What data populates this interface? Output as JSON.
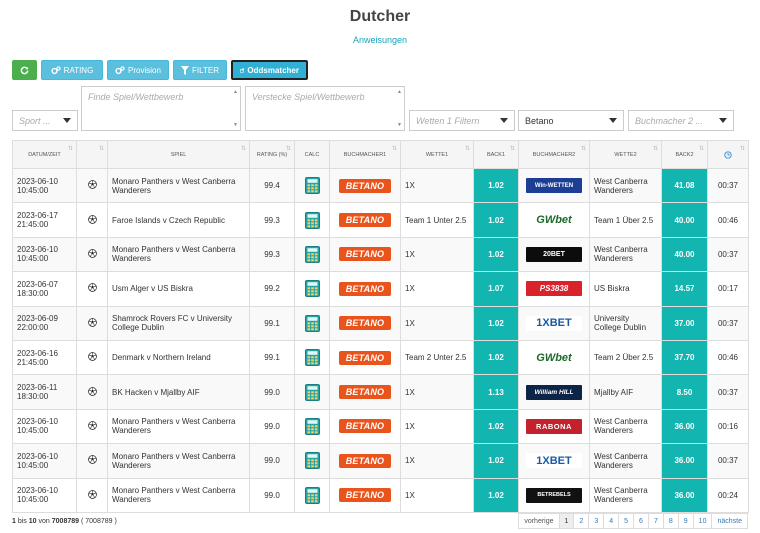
{
  "header": {
    "title": "Dutcher",
    "subtitle": "Anweisungen"
  },
  "toolbar": {
    "rating_label": "RATING",
    "provision_label": "Provision",
    "filter_label": "FILTER",
    "oddsmatcher_label": "Oddsmatcher"
  },
  "filters": {
    "sport_placeholder": "Sport ...",
    "find_placeholder": "Finde Spiel/Wettbewerb",
    "hide_placeholder": "Verstecke Spiel/Wettbewerb",
    "bet1_placeholder": "Wetten 1 Filtern",
    "bookmaker1_value": "Betano",
    "bookmaker2_placeholder": "Buchmacher 2 ..."
  },
  "table": {
    "headers": [
      "DATUM/ZEIT",
      "",
      "SPIEL",
      "RATING (%)",
      "CALC",
      "BUCHMACHER1",
      "WETTE1",
      "BACK1",
      "BUCHMACHER2",
      "WETTE2",
      "BACK2",
      ""
    ],
    "rows": [
      {
        "date": "2023-06-10",
        "time": "10:45:00",
        "game": "Monaro Panthers v West Canberra Wanderers",
        "rating": "99.4",
        "bk1": "BETANO",
        "bet1": "1X",
        "back1": "1.02",
        "bk2": "Win-WETTEN",
        "bet2": "West Canberra Wanderers",
        "back2": "41.08",
        "ago": "00:37"
      },
      {
        "date": "2023-06-17",
        "time": "21:45:00",
        "game": "Faroe Islands v Czech Republic",
        "rating": "99.3",
        "bk1": "BETANO",
        "bet1": "Team 1 Unter 2.5",
        "back1": "1.02",
        "bk2": "GWbet",
        "bet2": "Team 1 Über 2.5",
        "back2": "40.00",
        "ago": "00:46"
      },
      {
        "date": "2023-06-10",
        "time": "10:45:00",
        "game": "Monaro Panthers v West Canberra Wanderers",
        "rating": "99.3",
        "bk1": "BETANO",
        "bet1": "1X",
        "back1": "1.02",
        "bk2": "20BET",
        "bet2": "West Canberra Wanderers",
        "back2": "40.00",
        "ago": "00:37"
      },
      {
        "date": "2023-06-07",
        "time": "18:30:00",
        "game": "Usm Alger v US Biskra",
        "rating": "99.2",
        "bk1": "BETANO",
        "bet1": "1X",
        "back1": "1.07",
        "bk2": "PS3838",
        "bet2": "US Biskra",
        "back2": "14.57",
        "ago": "00:17"
      },
      {
        "date": "2023-06-09",
        "time": "22:00:00",
        "game": "Shamrock Rovers FC v University College Dublin",
        "rating": "99.1",
        "bk1": "BETANO",
        "bet1": "1X",
        "back1": "1.02",
        "bk2": "1XBET",
        "bet2": "University College Dublin",
        "back2": "37.00",
        "ago": "00:37"
      },
      {
        "date": "2023-06-16",
        "time": "21:45:00",
        "game": "Denmark v Northern Ireland",
        "rating": "99.1",
        "bk1": "BETANO",
        "bet1": "Team 2 Unter 2.5",
        "back1": "1.02",
        "bk2": "GWbet",
        "bet2": "Team 2 Über 2.5",
        "back2": "37.70",
        "ago": "00:46"
      },
      {
        "date": "2023-06-11",
        "time": "18:30:00",
        "game": "BK Hacken v Mjallby AIF",
        "rating": "99.0",
        "bk1": "BETANO",
        "bet1": "1X",
        "back1": "1.13",
        "bk2": "William HILL",
        "bet2": "Mjallby AIF",
        "back2": "8.50",
        "ago": "00:37"
      },
      {
        "date": "2023-06-10",
        "time": "10:45:00",
        "game": "Monaro Panthers v West Canberra Wanderers",
        "rating": "99.0",
        "bk1": "BETANO",
        "bet1": "1X",
        "back1": "1.02",
        "bk2": "RABONA",
        "bet2": "West Canberra Wanderers",
        "back2": "36.00",
        "ago": "00:16"
      },
      {
        "date": "2023-06-10",
        "time": "10:45:00",
        "game": "Monaro Panthers v West Canberra Wanderers",
        "rating": "99.0",
        "bk1": "BETANO",
        "bet1": "1X",
        "back1": "1.02",
        "bk2": "1XBET",
        "bet2": "West Canberra Wanderers",
        "back2": "36.00",
        "ago": "00:37"
      },
      {
        "date": "2023-06-10",
        "time": "10:45:00",
        "game": "Monaro Panthers v West Canberra Wanderers",
        "rating": "99.0",
        "bk1": "BETANO",
        "bet1": "1X",
        "back1": "1.02",
        "bk2": "BETREBELS",
        "bet2": "West Canberra Wanderers",
        "back2": "36.00",
        "ago": "00:24"
      }
    ]
  },
  "footer": {
    "range_start": "1",
    "bis": "bis",
    "range_end": "10",
    "von": "von",
    "total": "7008789",
    "total_paren": "( 7008789 )",
    "prev": "vorherige",
    "pages": [
      "1",
      "2",
      "3",
      "4",
      "5",
      "6",
      "7",
      "8",
      "9",
      "10"
    ],
    "next": "nächste"
  },
  "colors": {
    "back_cell": "#13b5b1",
    "betano": "#e8541c",
    "cyan_button": "#5bc0de",
    "green_button": "#4cae4c"
  },
  "icons": {
    "refresh": "refresh-icon",
    "rating": "cogs-icon",
    "provision": "cogs-icon",
    "filter": "filter-icon",
    "oddsmatcher": "external-link-icon",
    "clock": "clock-icon",
    "ball": "football-icon",
    "calc": "calculator-icon"
  }
}
